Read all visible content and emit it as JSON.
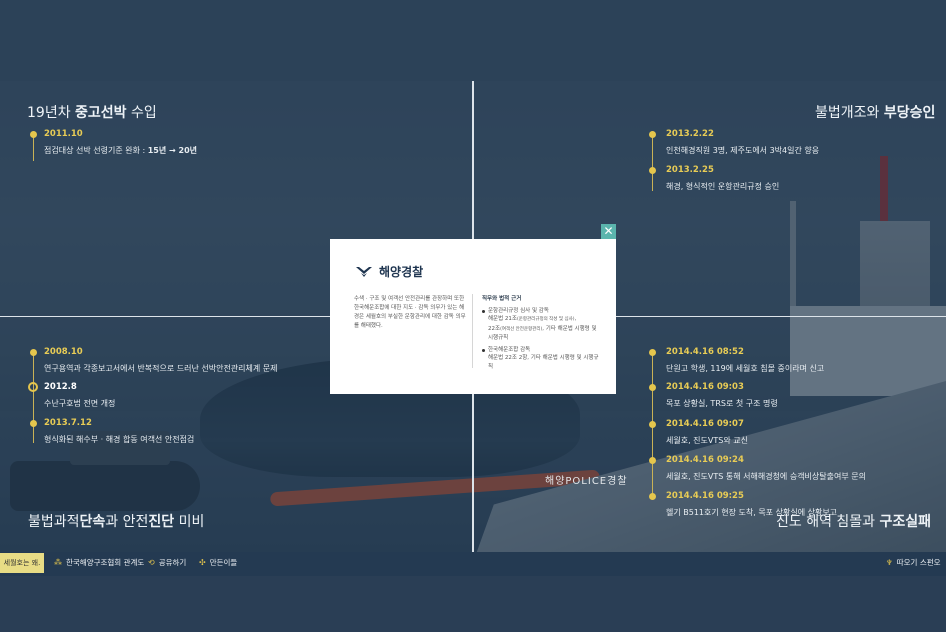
{
  "colors": {
    "accent": "#e5c64d",
    "navy": "#243a52",
    "modal_close": "#5bb5ad",
    "badge": "#e8dc85"
  },
  "sections": {
    "top_left": {
      "title_normal": "19년차 ",
      "title_bold": "중고선박",
      "title_after": " 수입"
    },
    "top_right": {
      "title_normal": "불법개조와 ",
      "title_bold": "부당승인"
    },
    "bottom_left": {
      "title_normal1": "불법과적",
      "title_bold1": "단속",
      "title_normal2": "과 안전",
      "title_bold2": "진단",
      "title_normal3": " 미비"
    },
    "bottom_right": {
      "title_normal": "진도 해역 침몰과 ",
      "title_bold": "구조실패"
    }
  },
  "timeline_top_left": [
    {
      "date": "2011.10",
      "desc_normal": "점검대상 선박 선령기준 완화 : ",
      "desc_bold": "15년 → 20년"
    }
  ],
  "timeline_top_right": [
    {
      "date": "2013.2.22",
      "desc": "인천해경직원 3명, 제주도에서 3박4일간 향응"
    },
    {
      "date": "2013.2.25",
      "desc": "해경, 형식적인 운항관리규정 승인"
    }
  ],
  "timeline_bottom_left": [
    {
      "date": "2008.10",
      "desc": "연구용역과 각종보고서에서 반복적으로 드러난 선박안전관리체계 문제"
    },
    {
      "date": "2012.8",
      "desc": "수난구호법 전면 개정"
    },
    {
      "date": "2013.7.12",
      "desc": "형식화된 해수부 · 해경 합동 여객선 안전점검"
    }
  ],
  "timeline_bottom_right": [
    {
      "date": "2014.4.16 08:52",
      "desc": "단원고 학생, 119에 세월호 침몰 중이라며 신고"
    },
    {
      "date": "2014.4.16 09:03",
      "desc": "목포 상황실, TRS로 첫 구조 명령"
    },
    {
      "date": "2014.4.16 09:07",
      "desc": "세월호, 진도VTS와 교신"
    },
    {
      "date": "2014.4.16 09:24",
      "desc": "세월호, 진도VTS 통해 서해해경청에 승객비상탈출여부 문의"
    },
    {
      "date": "2014.4.16 09:25",
      "desc": "헬기 B511호기 현장 도착, 목포 상황실에 상황보고"
    }
  ],
  "modal": {
    "close": "✕",
    "logo_icon": "coast-guard-emblem-icon",
    "title": "해양경찰",
    "description": "수색 · 구조 및 여객선 안전관리를 관장하며 또한 한국해운조합에 대한 지도 · 감독 의무가 있는 해경은 세월호의 부실한 운항관리에 대한 감독 의무를 해태했다.",
    "right_head": "직무와 법적 근거",
    "bullets": [
      {
        "main": "운항관리규정 심사 및 감독",
        "sub1": "해운법 21조",
        "sub1_small": "(운항관리규정의 작성 및 심사)",
        "sub2": "22조",
        "sub2_small": "(여객선 안전운항관리)",
        "sub3": ", 기타 해운법 시행령 및 시행규칙"
      },
      {
        "main": "한국해운조합 감독",
        "sub1": "해운법 22조 2항, 기타 해운법 시행령 및 시행규칙"
      }
    ]
  },
  "footer": {
    "badge": "세월호는 왜.",
    "link1": "한국해양구조협회 관계도",
    "link2": "공유하기",
    "link3": "만든이들",
    "right": "따오기 스펀오"
  },
  "scene": {
    "police_marking": "해양POLICE경찰"
  }
}
